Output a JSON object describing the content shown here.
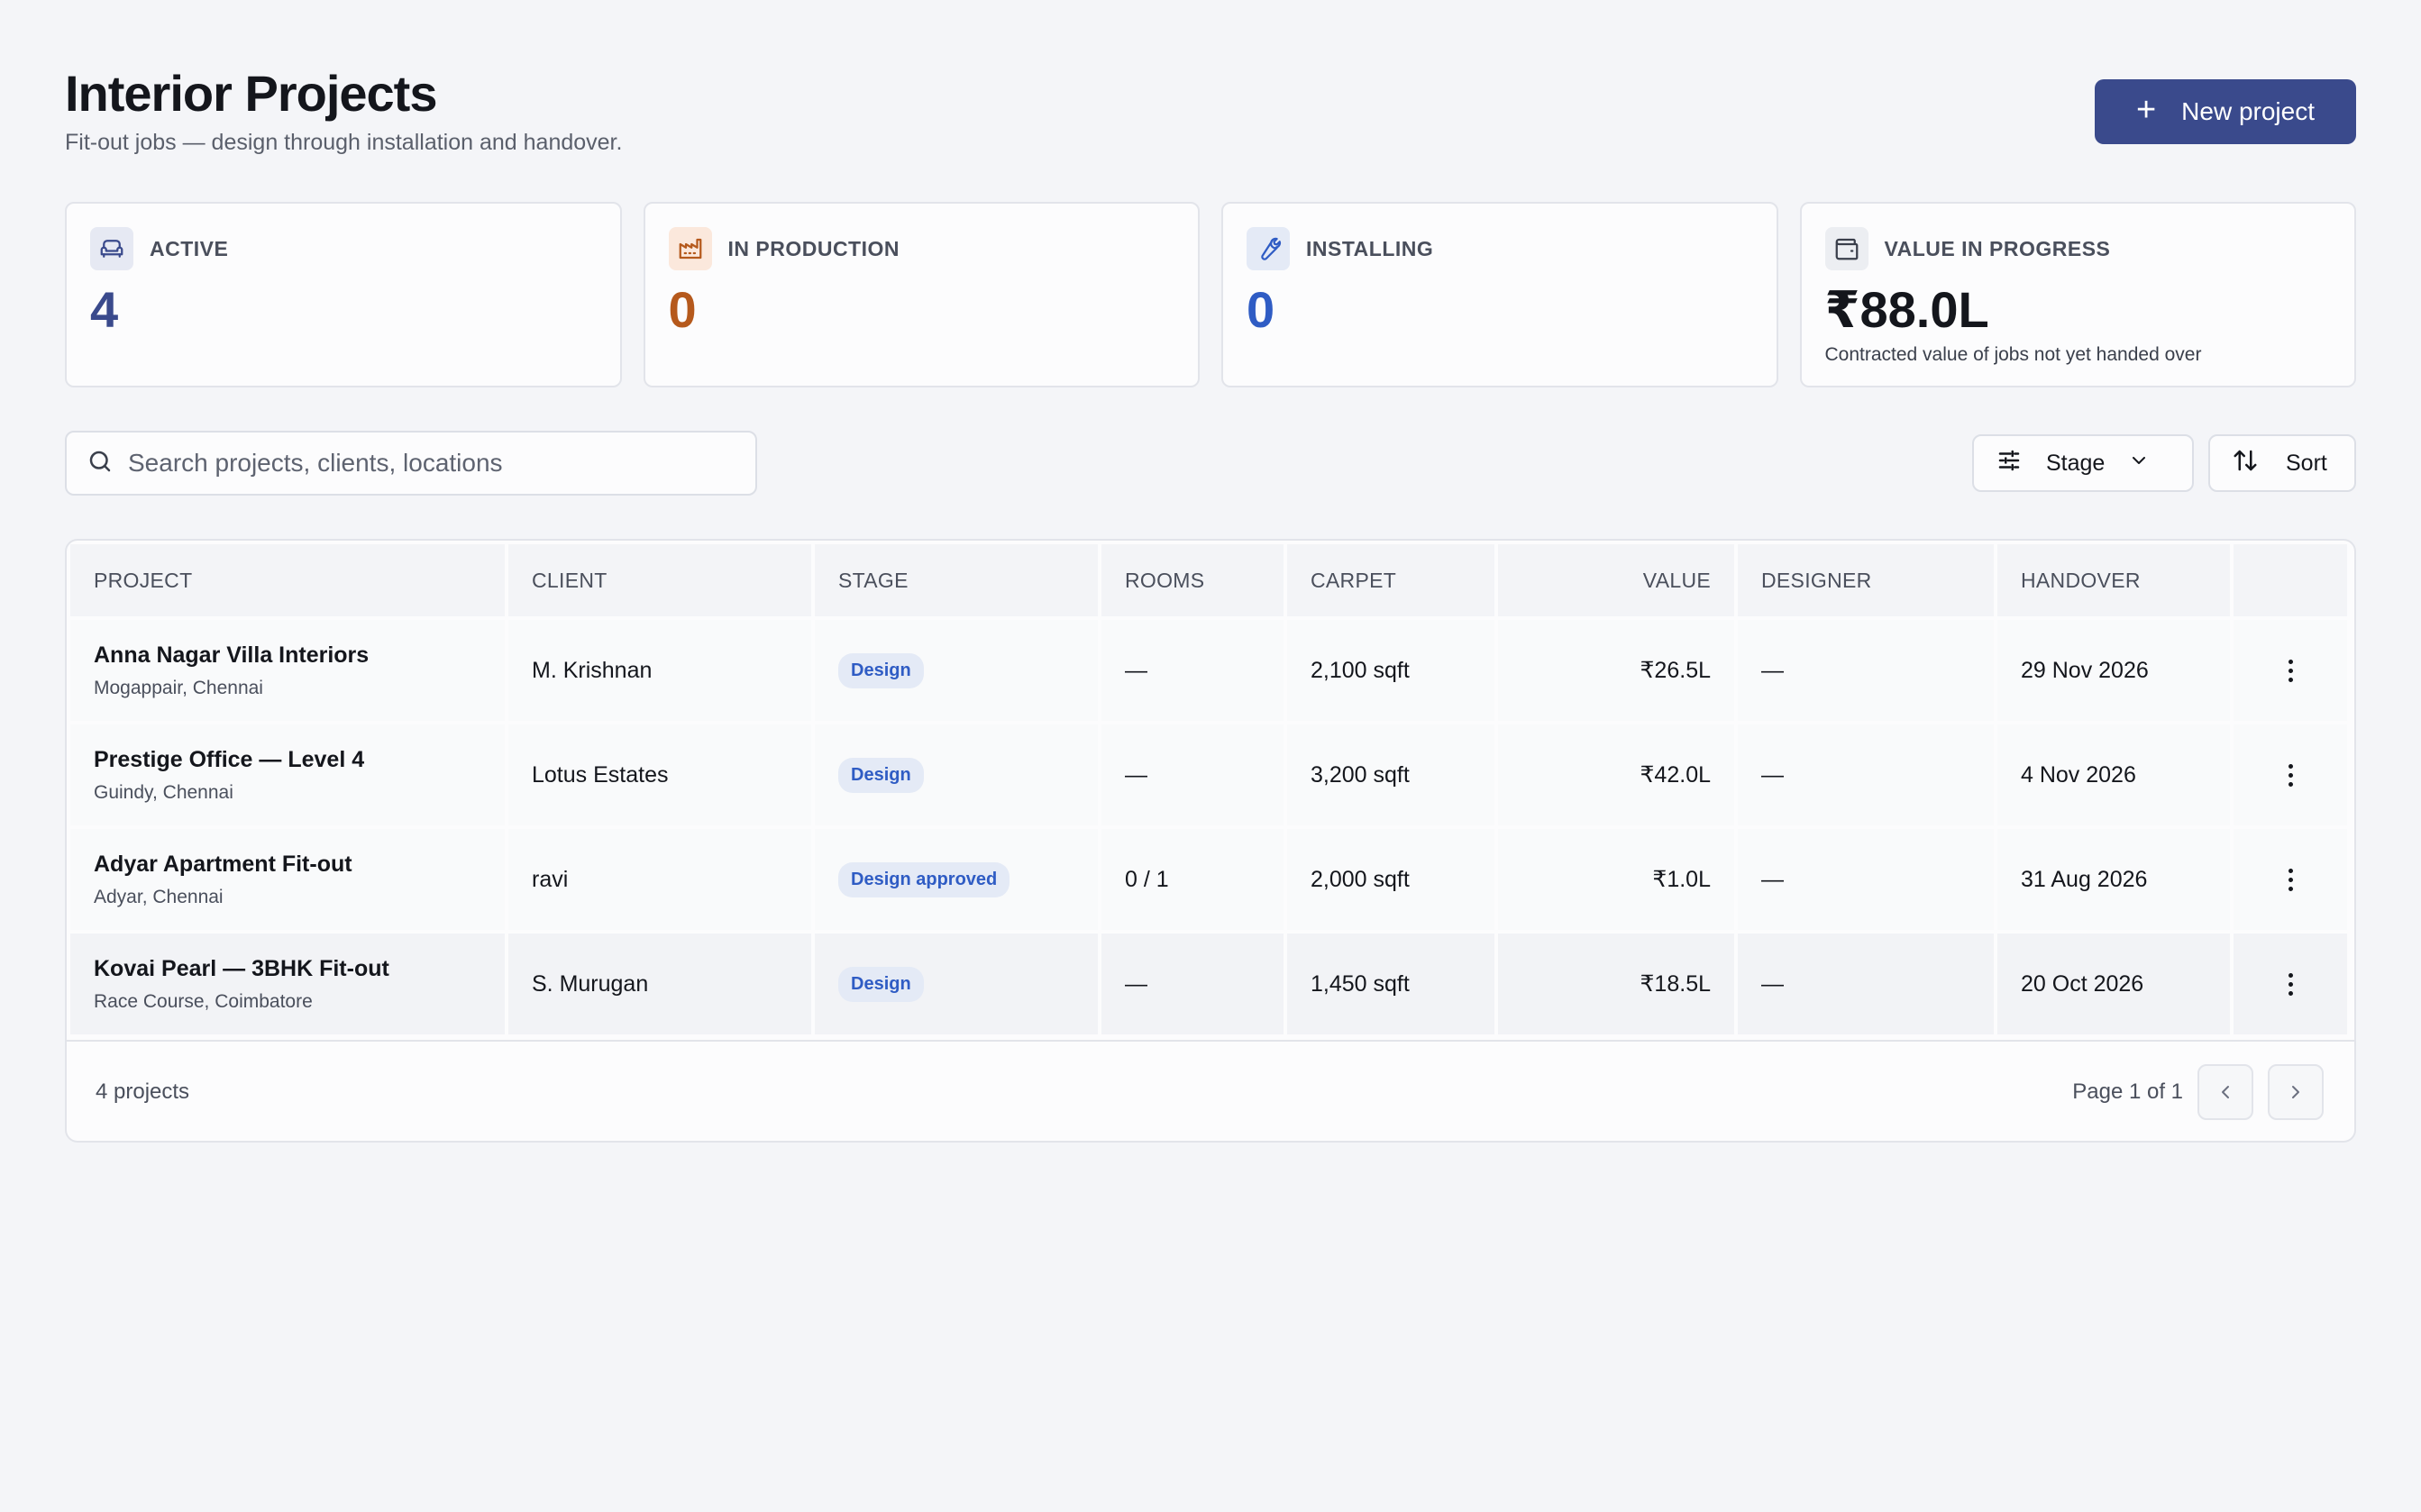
{
  "header": {
    "title": "Interior Projects",
    "subtitle": "Fit-out jobs — design through installation and handover.",
    "new_button_label": "New project",
    "new_button_color": "#3a4a8c"
  },
  "stats": [
    {
      "label": "ACTIVE",
      "value": "4",
      "icon": "sofa-icon",
      "color": "#3a4a8c",
      "icon_bg": "#e6e9f3"
    },
    {
      "label": "IN PRODUCTION",
      "value": "0",
      "icon": "factory-icon",
      "color": "#b5591c",
      "icon_bg": "#fbe8dc"
    },
    {
      "label": "INSTALLING",
      "value": "0",
      "icon": "wrench-icon",
      "color": "#2f5cc4",
      "icon_bg": "#e4eaf6"
    },
    {
      "label": "VALUE IN PROGRESS",
      "value": "₹88.0L",
      "note": "Contracted value of jobs not yet handed over",
      "icon": "wallet-icon",
      "color": "#14161c",
      "icon_bg": "#eceef2"
    }
  ],
  "toolbar": {
    "search_placeholder": "Search projects, clients, locations",
    "stage_label": "Stage",
    "sort_label": "Sort"
  },
  "table": {
    "columns": [
      "PROJECT",
      "CLIENT",
      "STAGE",
      "ROOMS",
      "CARPET",
      "VALUE",
      "DESIGNER",
      "HANDOVER"
    ],
    "rows": [
      {
        "project": "Anna Nagar Villa Interiors",
        "location": "Mogappair, Chennai",
        "client": "M. Krishnan",
        "stage": "Design",
        "rooms": "—",
        "carpet": "2,100 sqft",
        "value": "₹26.5L",
        "designer": "—",
        "handover": "29 Nov 2026"
      },
      {
        "project": "Prestige Office — Level 4",
        "location": "Guindy, Chennai",
        "client": "Lotus Estates",
        "stage": "Design",
        "rooms": "—",
        "carpet": "3,200 sqft",
        "value": "₹42.0L",
        "designer": "—",
        "handover": "4 Nov 2026"
      },
      {
        "project": "Adyar Apartment Fit-out",
        "location": "Adyar, Chennai",
        "client": "ravi",
        "stage": "Design approved",
        "rooms": "0 / 1",
        "carpet": "2,000 sqft",
        "value": "₹1.0L",
        "designer": "—",
        "handover": "31 Aug 2026"
      },
      {
        "project": "Kovai Pearl — 3BHK Fit-out",
        "location": "Race Course, Coimbatore",
        "client": "S. Murugan",
        "stage": "Design",
        "rooms": "—",
        "carpet": "1,450 sqft",
        "value": "₹18.5L",
        "designer": "—",
        "handover": "20 Oct 2026"
      }
    ],
    "footer_count": "4 projects",
    "page_info": "Page 1 of 1"
  }
}
